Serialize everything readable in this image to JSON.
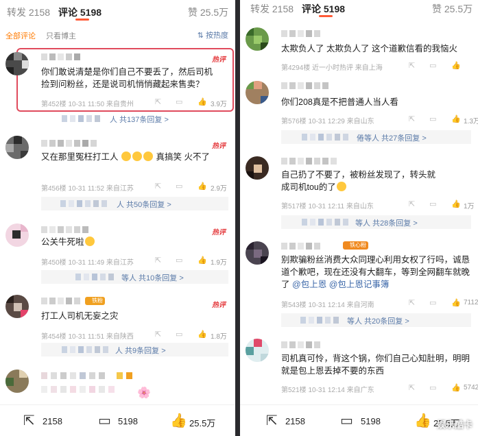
{
  "tabs": {
    "repost": "转发 2158",
    "comment": "评论 5198",
    "like": "赞 25.5万"
  },
  "filter": {
    "all": "全部评论",
    "blogger": "只看博主",
    "sort": "按热度"
  },
  "left_comments": [
    {
      "text": "你们敢说清楚是你们自己不要丢了，然后司机捡到问粉丝，还是说司机悄悄藏起来售卖？",
      "meta": "第452楼  10-31 11:50  来自贵州",
      "likes": "3.9万",
      "hot": "热评",
      "replies": "人  共137条回复 >"
    },
    {
      "text": "又在那里冤枉打工人",
      "text2": "真搞笑   火不了",
      "meta": "第456楼  10-31 11:52  来自江苏",
      "likes": "2.9万",
      "hot": "热评",
      "replies": "人  共50条回复 >"
    },
    {
      "text": "公关牛死啦",
      "meta": "第450楼  10-31 11:49  来自江苏",
      "likes": "1.9万",
      "hot": "热评",
      "replies": "等人  共10条回复 >"
    },
    {
      "text": "打工人司机无妄之灾",
      "meta": "第454楼  10-31 11:51  来自陕西",
      "likes": "1.8万",
      "hot": "热评",
      "replies": "人  共9条回复 >",
      "badge": "铁粉"
    },
    {
      "text": "",
      "meta": "",
      "likes": ""
    }
  ],
  "right_comments": [
    {
      "text": "太欺负人了 太欺负人了 这个道歉信看的我恼火",
      "meta": "第4294楼  近一小时热评  来自上海",
      "likes": ""
    },
    {
      "text": "你们208真是不把普通人当人看",
      "meta": "第576楼  10-31 12:29  来自山东",
      "likes": "1.3万",
      "replies": "倦等人  共27条回复 >"
    },
    {
      "text": "自己扔了不要了，被粉丝发现了，转头就成司机tou的了",
      "meta": "第517楼  10-31 12:11  来自山东",
      "likes": "1万",
      "replies": "等人  共28条回复 >"
    },
    {
      "text": "别欺骗粉丝消费大众同理心利用女权了行吗，诚恳道个歉吧，现在还没有大翻车，等到全网翻车就晚了",
      "mention1": "@包上恩",
      "mention2": "@包上恩记事簿",
      "meta": "第543楼  10-31 12:14  来自河南",
      "likes": "7112",
      "replies": "等人  共20条回复 >",
      "badge": "铁心粉"
    },
    {
      "text": "司机真可怜，背这个锅，你们自己心知肚明，明明就是包上恩丢掉不要的东西",
      "meta": "第521楼  10-31 12:14  来自广东",
      "likes": "5742"
    }
  ],
  "bottom": {
    "repost": "2158",
    "comment": "5198",
    "like": "25.5万"
  },
  "watermark": "娱乐酷卡",
  "icons": {
    "share": "share-icon",
    "comment": "comment-icon",
    "like": "thumb-up-icon"
  },
  "colors": {
    "accent": "#ff5a36",
    "hot": "#e4393c",
    "link": "#5a7aa8",
    "highlight": "#e04a5c"
  }
}
